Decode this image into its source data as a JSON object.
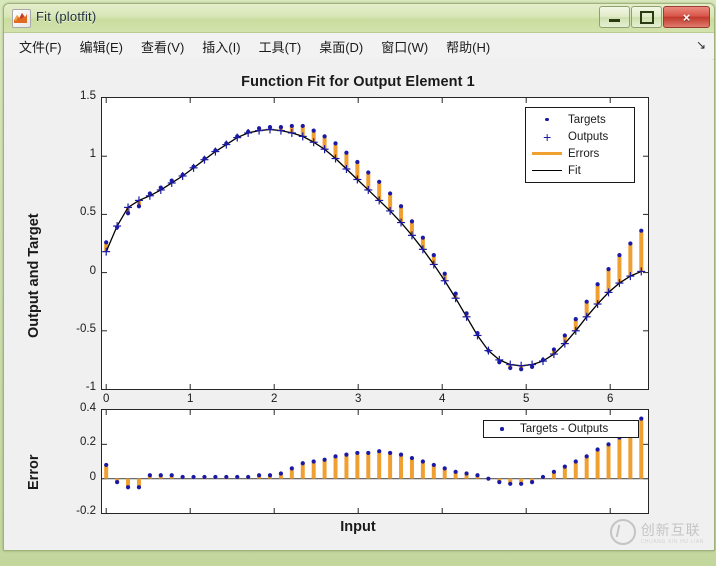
{
  "window": {
    "title": "Fit (plotfit)",
    "icon": "matlab-membrane-icon",
    "buttons": {
      "minimize": "minimize-button",
      "maximize": "maximize-button",
      "close": "×"
    }
  },
  "menubar": {
    "items": [
      {
        "label": "文件(F)",
        "name": "menu-file"
      },
      {
        "label": "编辑(E)",
        "name": "menu-edit"
      },
      {
        "label": "查看(V)",
        "name": "menu-view"
      },
      {
        "label": "插入(I)",
        "name": "menu-insert"
      },
      {
        "label": "工具(T)",
        "name": "menu-tools"
      },
      {
        "label": "桌面(D)",
        "name": "menu-desktop"
      },
      {
        "label": "窗口(W)",
        "name": "menu-window"
      },
      {
        "label": "帮助(H)",
        "name": "menu-help"
      }
    ],
    "dock_arrow": "↘"
  },
  "watermark": {
    "text": "创新互联",
    "subtext": "CHUANG XIN HU LIAN"
  },
  "colors": {
    "targets": "#1a1aa6",
    "outputs": "#1a1aa6",
    "errors": "#f0a030",
    "fit": "#000000",
    "axes": "#262626",
    "figure_bg": "#f0f0f0",
    "plot_bg": "#ffffff",
    "titlebar": "#d8e6b6",
    "close_button": "#c03a2d"
  },
  "chart_data": [
    {
      "type": "scatter",
      "name": "function-fit-plot",
      "title": "Function Fit for Output Element 1",
      "xlabel": "",
      "ylabel": "Output and Target",
      "xlim": [
        -0.05,
        6.45
      ],
      "ylim": [
        -1,
        1.5
      ],
      "xticks": [
        0,
        1,
        2,
        3,
        4,
        5,
        6
      ],
      "yticks": [
        -1,
        -0.5,
        0,
        0.5,
        1,
        1.5
      ],
      "grid": false,
      "legend": {
        "position": "top-right",
        "entries": [
          {
            "label": "Targets",
            "marker": "dot",
            "color": "#1a1aa6"
          },
          {
            "label": "Outputs",
            "marker": "plus",
            "color": "#1a1aa6"
          },
          {
            "label": "Errors",
            "marker": "line",
            "color": "#f0a030"
          },
          {
            "label": "Fit",
            "marker": "line",
            "color": "#000000"
          }
        ]
      },
      "x": [
        0.0,
        0.13,
        0.26,
        0.39,
        0.52,
        0.65,
        0.78,
        0.91,
        1.04,
        1.17,
        1.3,
        1.43,
        1.56,
        1.69,
        1.82,
        1.95,
        2.08,
        2.21,
        2.34,
        2.47,
        2.6,
        2.73,
        2.86,
        2.99,
        3.12,
        3.25,
        3.38,
        3.51,
        3.64,
        3.77,
        3.9,
        4.03,
        4.16,
        4.29,
        4.42,
        4.55,
        4.68,
        4.81,
        4.94,
        5.07,
        5.2,
        5.33,
        5.46,
        5.59,
        5.72,
        5.85,
        5.98,
        6.11,
        6.24,
        6.37
      ],
      "series": [
        {
          "name": "Outputs",
          "values": [
            0.18,
            0.4,
            0.56,
            0.62,
            0.66,
            0.71,
            0.77,
            0.83,
            0.9,
            0.97,
            1.04,
            1.1,
            1.16,
            1.2,
            1.22,
            1.23,
            1.22,
            1.2,
            1.17,
            1.12,
            1.06,
            0.98,
            0.89,
            0.8,
            0.71,
            0.62,
            0.53,
            0.43,
            0.32,
            0.2,
            0.07,
            -0.07,
            -0.22,
            -0.38,
            -0.54,
            -0.67,
            -0.75,
            -0.79,
            -0.8,
            -0.79,
            -0.76,
            -0.7,
            -0.61,
            -0.5,
            -0.38,
            -0.27,
            -0.17,
            -0.09,
            -0.03,
            0.01
          ]
        },
        {
          "name": "Targets",
          "values": [
            0.26,
            0.39,
            0.51,
            0.57,
            0.68,
            0.73,
            0.79,
            0.84,
            0.91,
            0.98,
            1.05,
            1.11,
            1.17,
            1.21,
            1.24,
            1.25,
            1.25,
            1.26,
            1.26,
            1.22,
            1.17,
            1.11,
            1.03,
            0.95,
            0.86,
            0.78,
            0.68,
            0.57,
            0.44,
            0.3,
            0.15,
            -0.01,
            -0.18,
            -0.35,
            -0.52,
            -0.67,
            -0.77,
            -0.82,
            -0.83,
            -0.81,
            -0.75,
            -0.66,
            -0.54,
            -0.4,
            -0.25,
            -0.1,
            0.03,
            0.15,
            0.25,
            0.36
          ]
        },
        {
          "name": "Fit",
          "values": [
            0.18,
            0.4,
            0.56,
            0.62,
            0.66,
            0.71,
            0.77,
            0.83,
            0.9,
            0.97,
            1.04,
            1.1,
            1.16,
            1.2,
            1.22,
            1.23,
            1.22,
            1.2,
            1.17,
            1.12,
            1.06,
            0.98,
            0.89,
            0.8,
            0.71,
            0.62,
            0.53,
            0.43,
            0.32,
            0.2,
            0.07,
            -0.07,
            -0.22,
            -0.38,
            -0.54,
            -0.67,
            -0.75,
            -0.79,
            -0.8,
            -0.79,
            -0.76,
            -0.7,
            -0.61,
            -0.5,
            -0.38,
            -0.27,
            -0.17,
            -0.09,
            -0.03,
            0.01
          ]
        }
      ]
    },
    {
      "type": "scatter",
      "name": "error-plot",
      "title": "",
      "xlabel": "Input",
      "ylabel": "Error",
      "xlim": [
        -0.05,
        6.45
      ],
      "ylim": [
        -0.2,
        0.4
      ],
      "xticks": [
        0,
        1,
        2,
        3,
        4,
        5,
        6
      ],
      "yticks": [
        -0.2,
        0,
        0.2,
        0.4
      ],
      "grid": false,
      "legend": {
        "position": "top-right",
        "entries": [
          {
            "label": "Targets - Outputs",
            "marker": "dot",
            "color": "#1a1aa6"
          }
        ]
      },
      "x": [
        0.0,
        0.13,
        0.26,
        0.39,
        0.52,
        0.65,
        0.78,
        0.91,
        1.04,
        1.17,
        1.3,
        1.43,
        1.56,
        1.69,
        1.82,
        1.95,
        2.08,
        2.21,
        2.34,
        2.47,
        2.6,
        2.73,
        2.86,
        2.99,
        3.12,
        3.25,
        3.38,
        3.51,
        3.64,
        3.77,
        3.9,
        4.03,
        4.16,
        4.29,
        4.42,
        4.55,
        4.68,
        4.81,
        4.94,
        5.07,
        5.2,
        5.33,
        5.46,
        5.59,
        5.72,
        5.85,
        5.98,
        6.11,
        6.24,
        6.37
      ],
      "series": [
        {
          "name": "Targets - Outputs",
          "values": [
            0.08,
            -0.02,
            -0.05,
            -0.05,
            0.02,
            0.02,
            0.02,
            0.01,
            0.01,
            0.01,
            0.01,
            0.01,
            0.01,
            0.01,
            0.02,
            0.02,
            0.03,
            0.06,
            0.09,
            0.1,
            0.11,
            0.13,
            0.14,
            0.15,
            0.15,
            0.16,
            0.15,
            0.14,
            0.12,
            0.1,
            0.08,
            0.06,
            0.04,
            0.03,
            0.02,
            0.0,
            -0.02,
            -0.03,
            -0.03,
            -0.02,
            0.01,
            0.04,
            0.07,
            0.1,
            0.13,
            0.17,
            0.2,
            0.24,
            0.28,
            0.35
          ]
        }
      ]
    }
  ]
}
